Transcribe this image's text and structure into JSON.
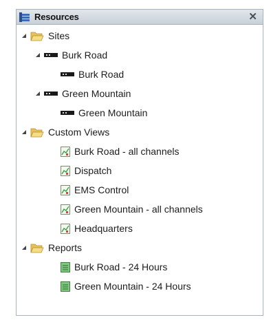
{
  "panel": {
    "title": "Resources",
    "close_glyph": "✕",
    "title_icon": "resources-icon"
  },
  "tree": {
    "sites": {
      "label": "Sites",
      "icon": "folder-open-icon",
      "children": [
        {
          "label": "Burk Road",
          "icon": "site-device-icon",
          "child": "Burk Road"
        },
        {
          "label": "Green Mountain",
          "icon": "site-device-icon",
          "child": "Green Mountain"
        }
      ]
    },
    "custom_views": {
      "label": "Custom Views",
      "icon": "folder-open-icon",
      "items": [
        "Burk Road - all channels",
        "Dispatch",
        "EMS Control",
        "Green Mountain - all channels",
        "Headquarters"
      ]
    },
    "reports": {
      "label": "Reports",
      "icon": "folder-open-icon",
      "items": [
        "Burk Road - 24 Hours",
        "Green Mountain - 24 Hours"
      ]
    }
  },
  "colors": {
    "folder": "#f2d274",
    "device": "#1a1a1a",
    "report": "#6fbf6f",
    "view_accent": "#3aa34a"
  }
}
